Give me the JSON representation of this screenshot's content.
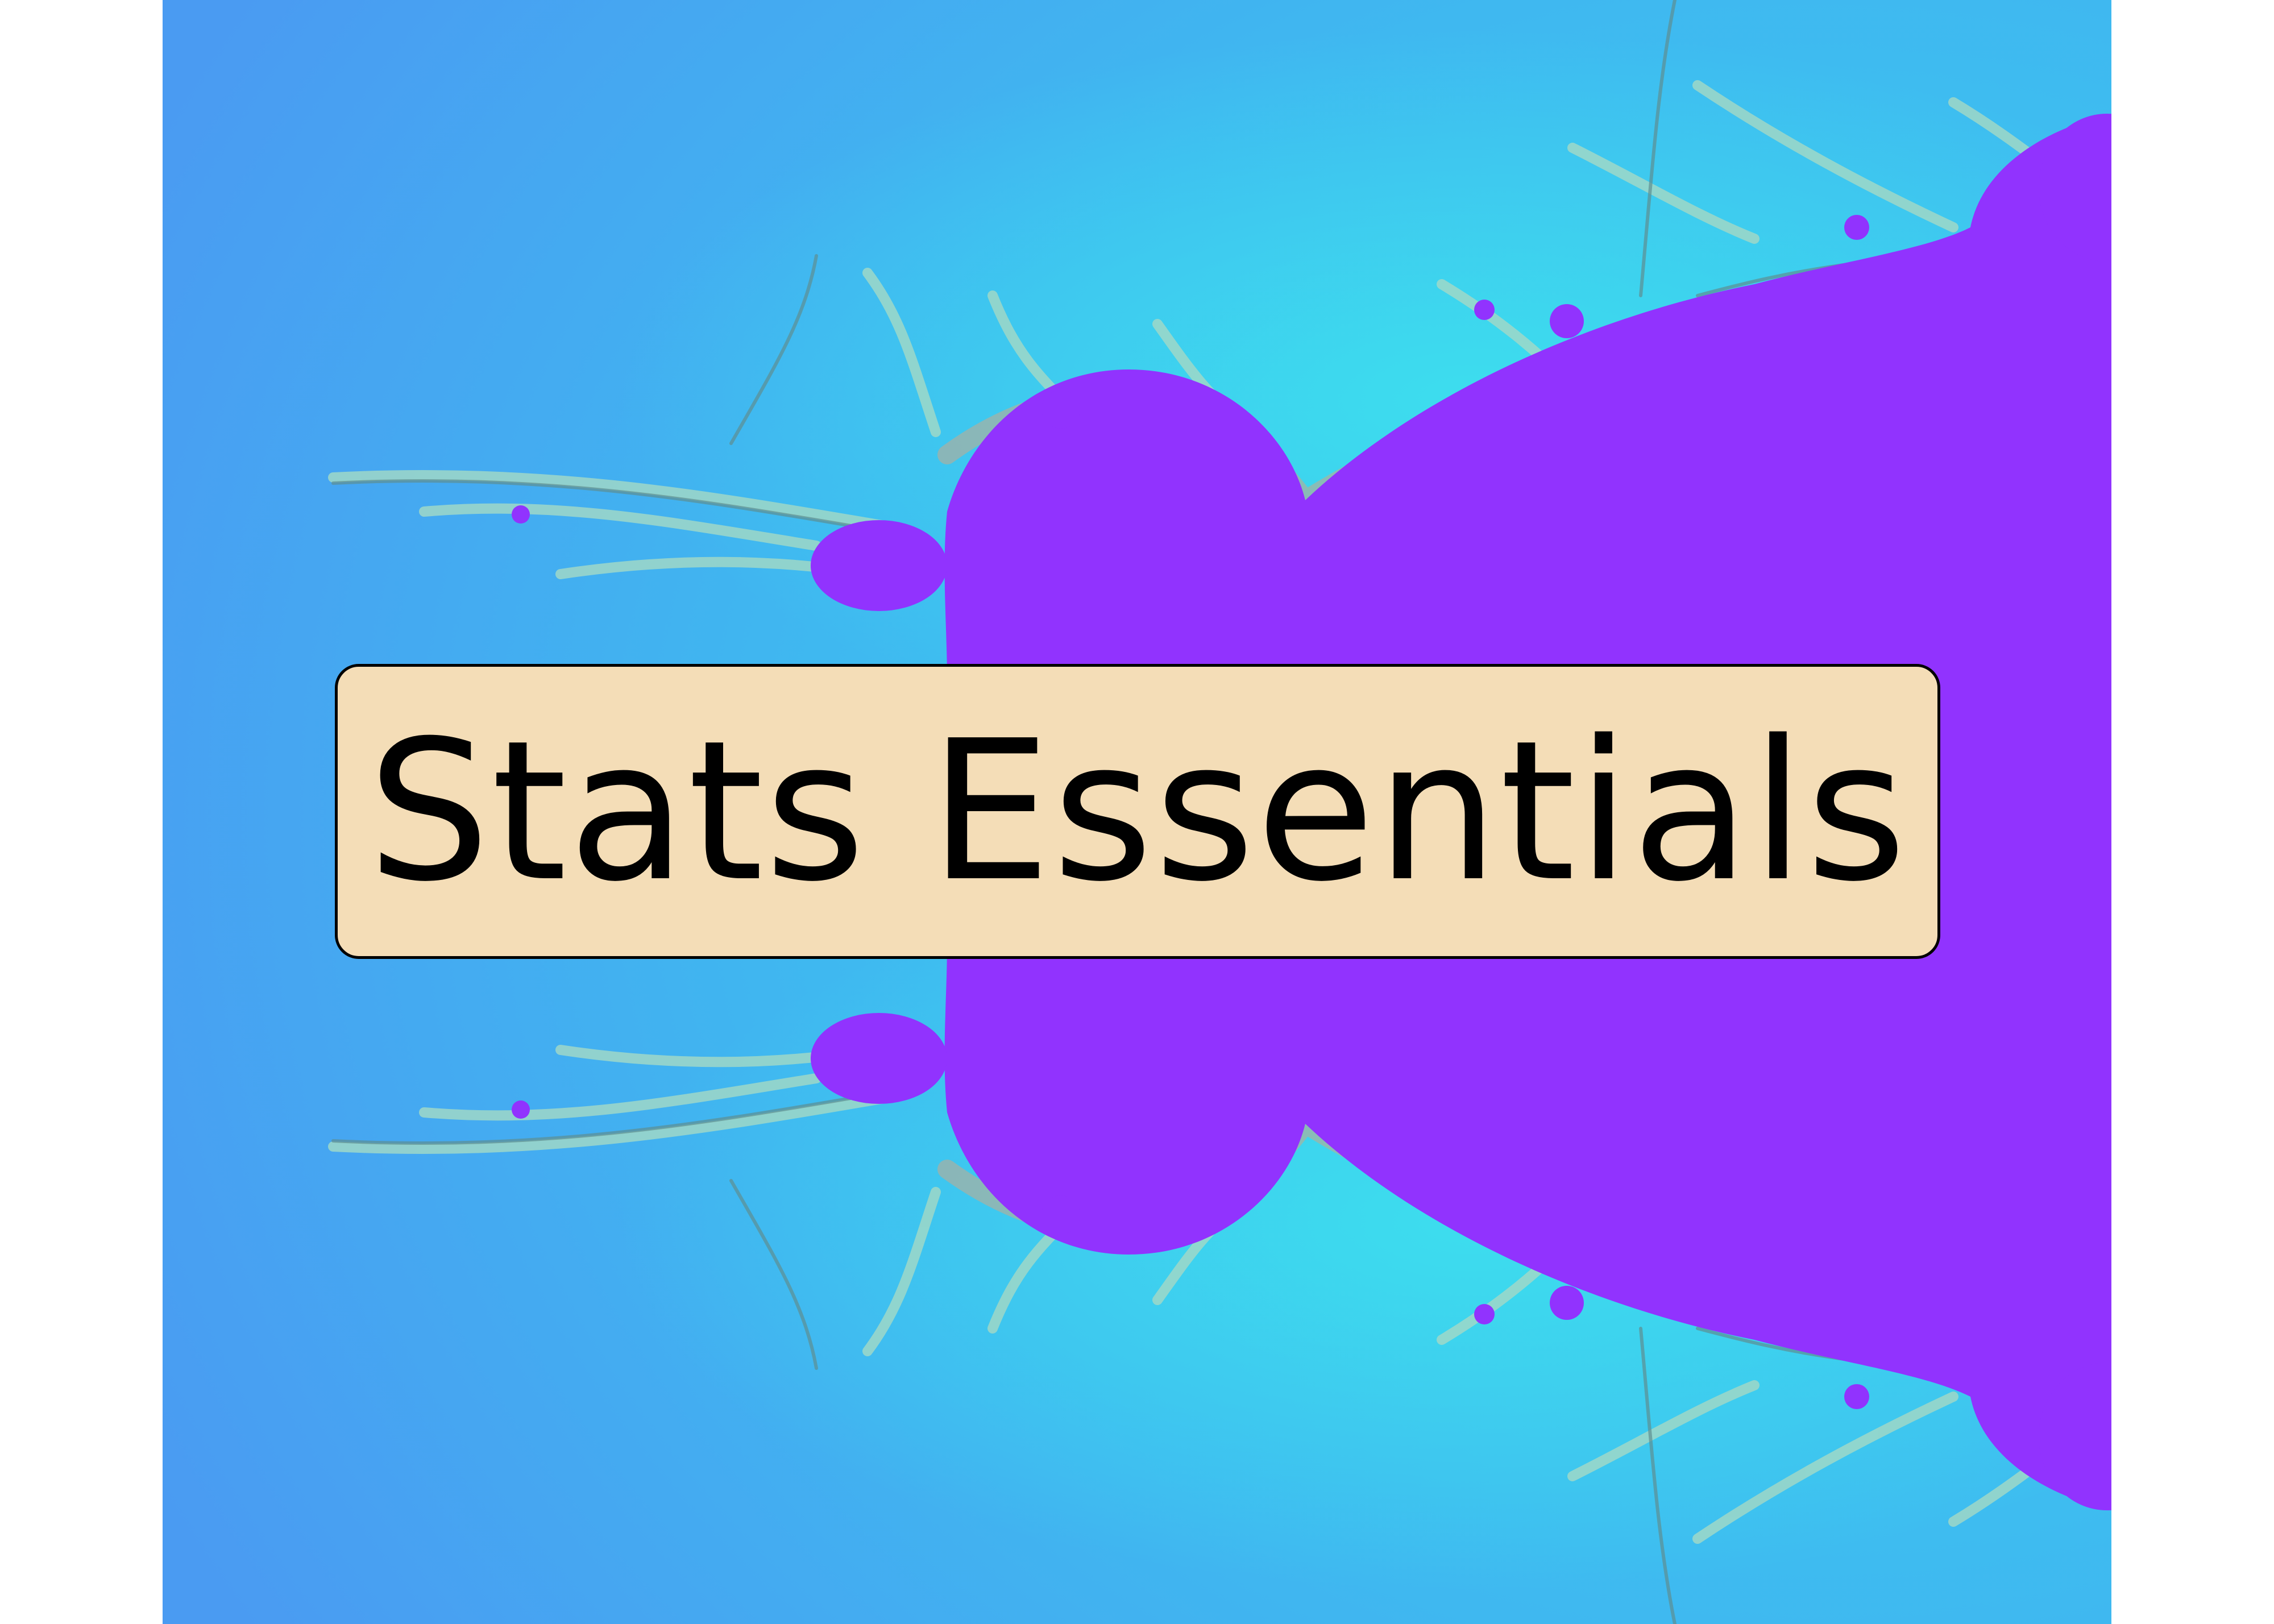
{
  "title": {
    "text": "Stats Essentials"
  },
  "colors": {
    "background_outer": "#4a9bf2",
    "background_inner": "#3ad3ee",
    "fractal_set": "#9133fe",
    "fractal_fringe": "#9fd8c8",
    "title_box_fill": "#f4ddb7",
    "title_box_border": "#000000",
    "title_text": "#000000",
    "page": "#ffffff"
  }
}
